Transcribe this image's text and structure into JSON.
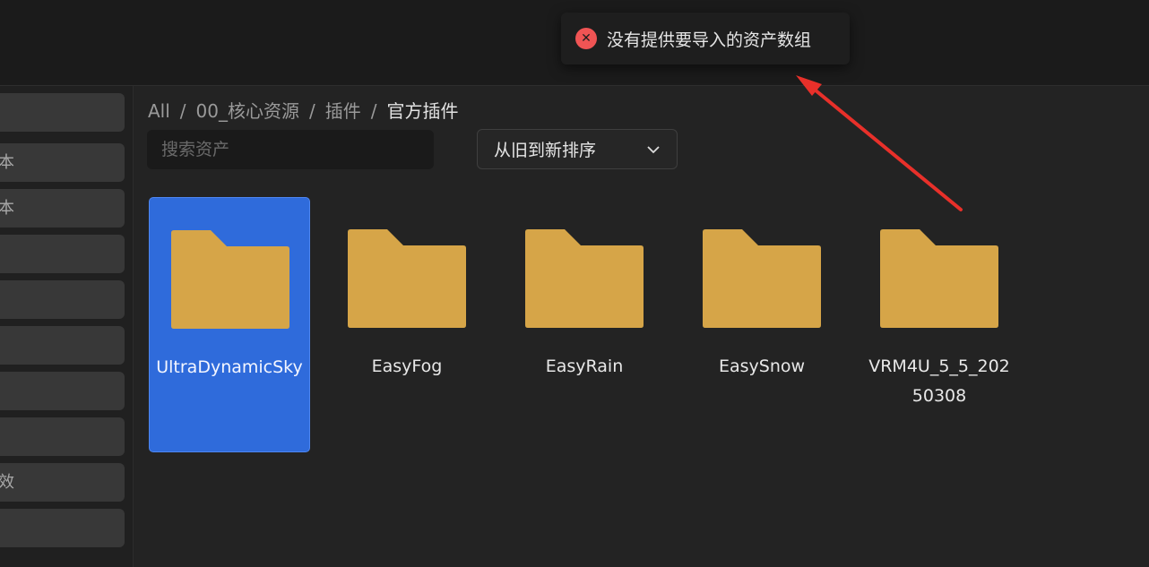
{
  "toast": {
    "icon": "error-circle-icon",
    "message": "没有提供要导入的资产数组",
    "color": "#f05454"
  },
  "sidebar": {
    "items": [
      {
        "label": ""
      },
      {
        "label": "本"
      },
      {
        "label": "本"
      },
      {
        "label": ""
      },
      {
        "label": ""
      },
      {
        "label": ""
      },
      {
        "label": ""
      },
      {
        "label": ""
      },
      {
        "label": "效"
      },
      {
        "label": ""
      }
    ]
  },
  "breadcrumb": {
    "items": [
      "All",
      "00_核心资源",
      "插件",
      "官方插件"
    ],
    "separator": "/"
  },
  "search": {
    "placeholder": "搜索资产",
    "value": ""
  },
  "sort": {
    "label": "从旧到新排序",
    "icon": "chevron-down-icon"
  },
  "folders": [
    {
      "name": "UltraDynamicSky",
      "selected": true
    },
    {
      "name": "EasyFog",
      "selected": false
    },
    {
      "name": "EasyRain",
      "selected": false
    },
    {
      "name": "EasySnow",
      "selected": false
    },
    {
      "name": "VRM4U_5_5_20250308",
      "selected": false
    }
  ],
  "colors": {
    "folder": "#d6a548",
    "folder_tab": "#d6a548",
    "selection": "#2f6bdb",
    "annotation_arrow": "#e8302a"
  }
}
